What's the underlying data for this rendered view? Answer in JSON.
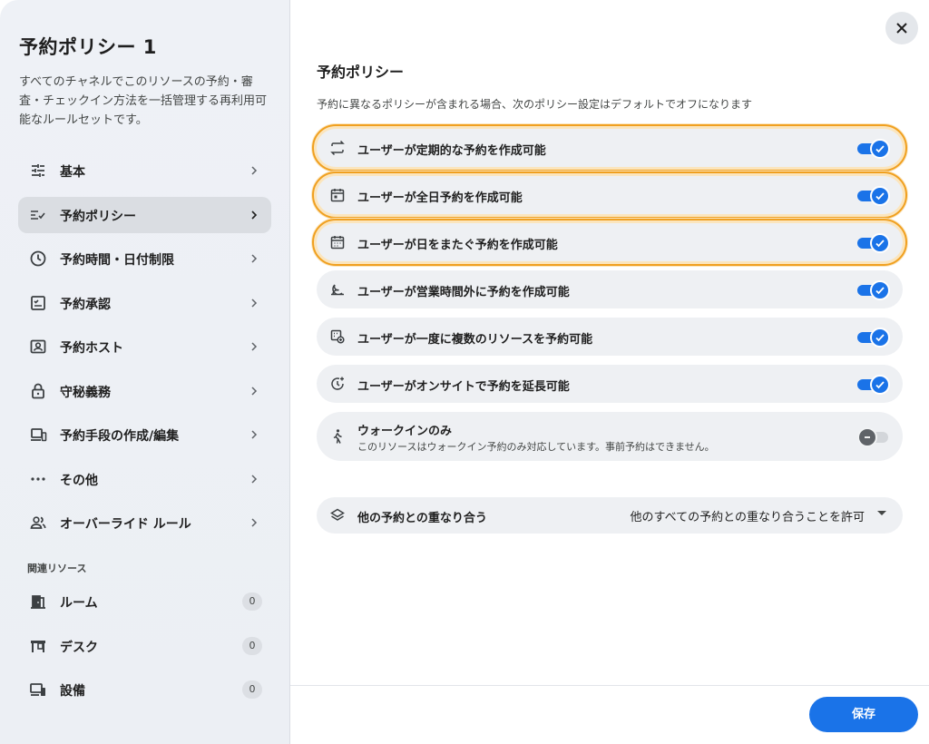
{
  "sidebar": {
    "title": "予約ポリシー 1",
    "description": "すべてのチャネルでこのリソースの予約・審査・チェックイン方法を一括管理する再利用可能なルールセットです。",
    "nav_items": [
      {
        "label": "基本",
        "icon": "tune-icon"
      },
      {
        "label": "予約ポリシー",
        "icon": "rule-icon",
        "active": true
      },
      {
        "label": "予約時間・日付制限",
        "icon": "clock-icon"
      },
      {
        "label": "予約承認",
        "icon": "approval-icon"
      },
      {
        "label": "予約ホスト",
        "icon": "host-icon"
      },
      {
        "label": "守秘義務",
        "icon": "lock-icon"
      },
      {
        "label": "予約手段の作成/編集",
        "icon": "devices-icon"
      },
      {
        "label": "その他",
        "icon": "more-icon"
      },
      {
        "label": "オーバーライド ルール",
        "icon": "group-icon"
      }
    ],
    "section_label": "関連リソース",
    "resources": [
      {
        "label": "ルーム",
        "count": "0",
        "icon": "door-icon"
      },
      {
        "label": "デスク",
        "count": "0",
        "icon": "desk-icon"
      },
      {
        "label": "設備",
        "count": "0",
        "icon": "equipment-icon"
      }
    ]
  },
  "main": {
    "title": "予約ポリシー",
    "note": "予約に異なるポリシーが含まれる場合、次のポリシー設定はデフォルトでオフになります",
    "settings": [
      {
        "label": "ユーザーが定期的な予約を作成可能",
        "icon": "repeat-icon",
        "enabled": true,
        "highlighted": true
      },
      {
        "label": "ユーザーが全日予約を作成可能",
        "icon": "calendar-day-icon",
        "enabled": true,
        "highlighted": true
      },
      {
        "label": "ユーザーが日をまたぐ予約を作成可能",
        "icon": "calendar-icon",
        "enabled": true,
        "highlighted": true
      },
      {
        "label": "ユーザーが営業時間外に予約を作成可能",
        "icon": "night-icon",
        "enabled": true,
        "highlighted": false
      },
      {
        "label": "ユーザーが一度に複数のリソースを予約可能",
        "icon": "multi-resource-icon",
        "enabled": true,
        "highlighted": false
      },
      {
        "label": "ユーザーがオンサイトで予約を延長可能",
        "icon": "extend-time-icon",
        "enabled": true,
        "highlighted": false
      }
    ],
    "walk_in": {
      "label": "ウォークインのみ",
      "sub": "このリソースはウォークイン予約のみ対応しています。事前予約はできません。",
      "icon": "walk-icon",
      "enabled": false
    },
    "overlap": {
      "label": "他の予約との重なり合う",
      "value": "他のすべての予約との重なり合うことを許可",
      "icon": "layers-icon"
    }
  },
  "footer": {
    "save_label": "保存"
  },
  "colors": {
    "accent": "#1a73e8",
    "highlight": "#f0a020"
  }
}
